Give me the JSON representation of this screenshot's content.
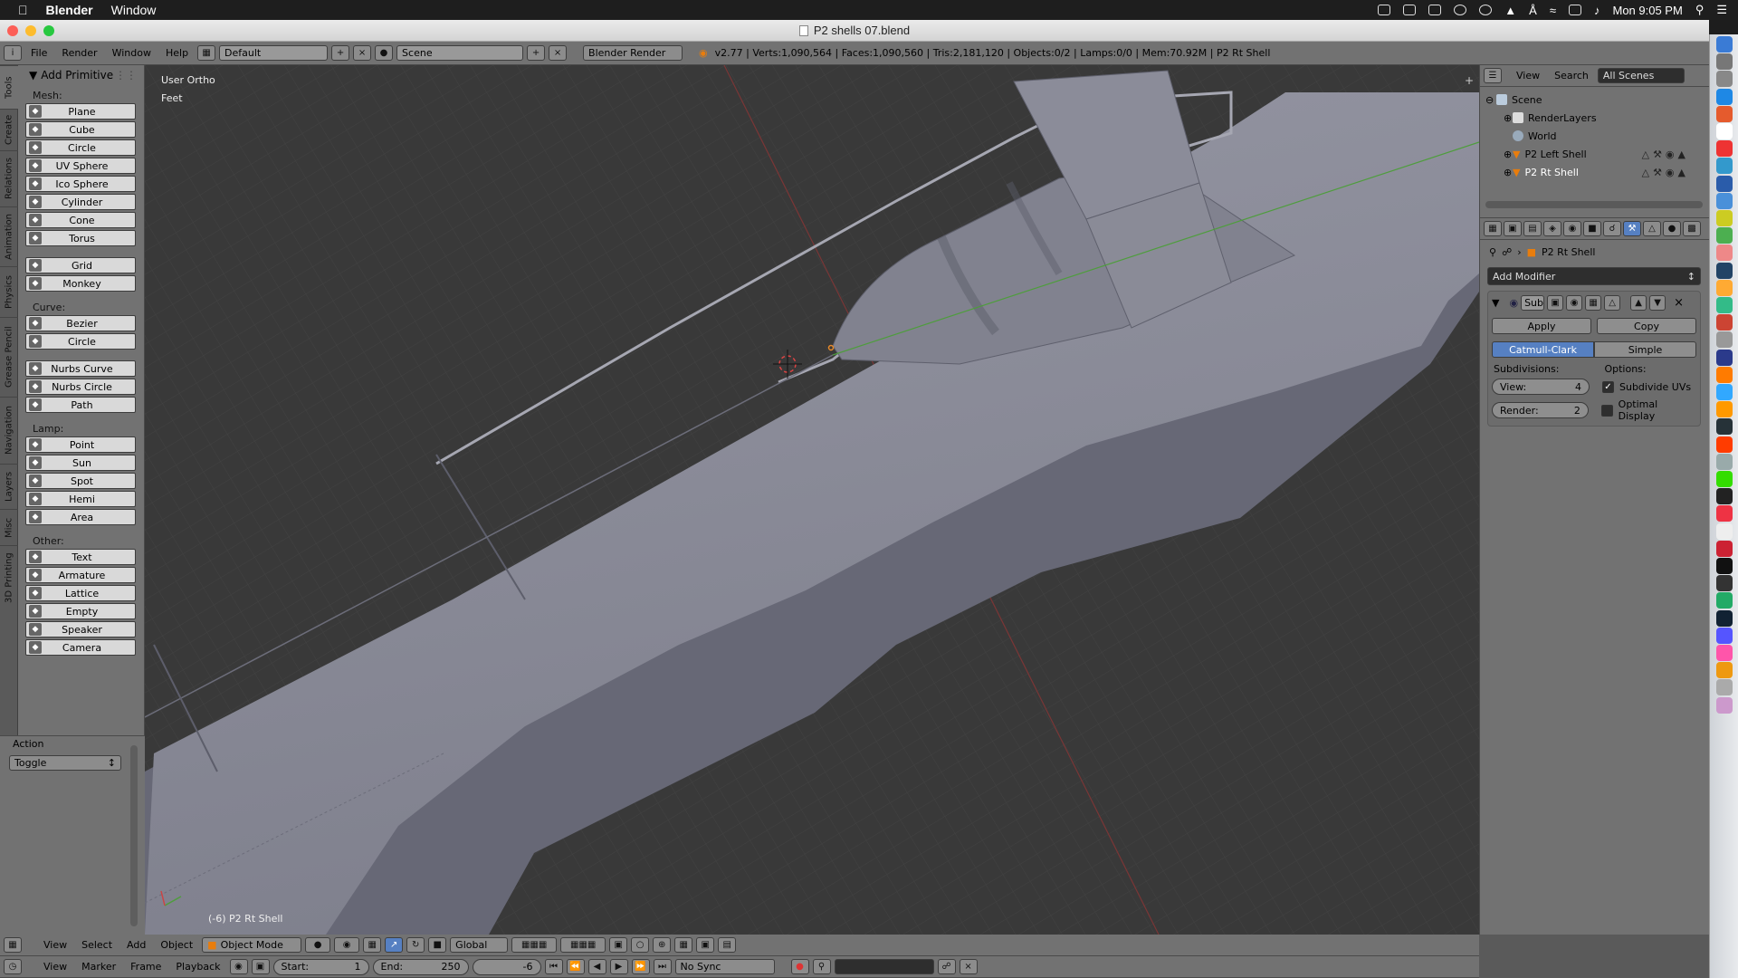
{
  "macos": {
    "apple_icon": "apple-icon",
    "app_name": "Blender",
    "menu_window": "Window",
    "clock": "Mon 9:05 PM",
    "tray_icons": [
      "hat-icon",
      "drive-icon",
      "dropbox-icon",
      "chat-icon",
      "timemachine-icon",
      "upload-icon",
      "bluetooth-icon",
      "wifi-icon",
      "keyboard-icon",
      "volume-icon"
    ]
  },
  "window": {
    "title": "P2 shells 07.blend"
  },
  "info_header": {
    "menus": [
      "File",
      "Render",
      "Window",
      "Help"
    ],
    "layout": "Default",
    "scene": "Scene",
    "engine": "Blender Render",
    "stats": "v2.77 | Verts:1,090,564 | Faces:1,090,560 | Tris:2,181,120 | Objects:0/2 | Lamps:0/0 | Mem:70.92M | P2 Rt Shell"
  },
  "tool_tabs": [
    "Tools",
    "Create",
    "Relations",
    "Animation",
    "Physics",
    "Grease Pencil",
    "Navigation",
    "Layers",
    "Misc",
    "3D Printing"
  ],
  "shelf": {
    "panel_title": "Add Primitive",
    "groups": [
      {
        "label": "Mesh:",
        "items": [
          {
            "label": "Plane",
            "icon": "plane-icon"
          },
          {
            "label": "Cube",
            "icon": "cube-icon"
          },
          {
            "label": "Circle",
            "icon": "circle-icon"
          },
          {
            "label": "UV Sphere",
            "icon": "uv-sphere-icon"
          },
          {
            "label": "Ico Sphere",
            "icon": "ico-sphere-icon"
          },
          {
            "label": "Cylinder",
            "icon": "cylinder-icon"
          },
          {
            "label": "Cone",
            "icon": "cone-icon"
          },
          {
            "label": "Torus",
            "icon": "torus-icon"
          }
        ]
      },
      {
        "label": "",
        "items": [
          {
            "label": "Grid",
            "icon": "grid-icon"
          },
          {
            "label": "Monkey",
            "icon": "monkey-icon"
          }
        ]
      },
      {
        "label": "Curve:",
        "items": [
          {
            "label": "Bezier",
            "icon": "bezier-icon"
          },
          {
            "label": "Circle",
            "icon": "curve-circle-icon"
          }
        ]
      },
      {
        "label": "",
        "items": [
          {
            "label": "Nurbs Curve",
            "icon": "nurbs-curve-icon"
          },
          {
            "label": "Nurbs Circle",
            "icon": "nurbs-circle-icon"
          },
          {
            "label": "Path",
            "icon": "path-icon"
          }
        ]
      },
      {
        "label": "Lamp:",
        "items": [
          {
            "label": "Point",
            "icon": "point-lamp-icon"
          },
          {
            "label": "Sun",
            "icon": "sun-lamp-icon"
          },
          {
            "label": "Spot",
            "icon": "spot-lamp-icon"
          },
          {
            "label": "Hemi",
            "icon": "hemi-lamp-icon"
          },
          {
            "label": "Area",
            "icon": "area-lamp-icon"
          }
        ]
      },
      {
        "label": "Other:",
        "items": [
          {
            "label": "Text",
            "icon": "text-icon"
          },
          {
            "label": "Armature",
            "icon": "armature-icon"
          },
          {
            "label": "Lattice",
            "icon": "lattice-icon"
          },
          {
            "label": "Empty",
            "icon": "empty-icon"
          },
          {
            "label": "Speaker",
            "icon": "speaker-icon"
          },
          {
            "label": "Camera",
            "icon": "camera-icon"
          }
        ]
      }
    ]
  },
  "operator": {
    "title": "Action",
    "value": "Toggle"
  },
  "viewport": {
    "view_name": "User Ortho",
    "units": "Feet",
    "object_label": "(-6) P2 Rt Shell"
  },
  "outliner": {
    "menus": [
      "View",
      "Search"
    ],
    "filter": "All Scenes",
    "items": [
      {
        "label": "Scene",
        "level": 0
      },
      {
        "label": "RenderLayers",
        "level": 1
      },
      {
        "label": "World",
        "level": 1
      },
      {
        "label": "P2 Left Shell",
        "level": 1
      },
      {
        "label": "P2 Rt Shell",
        "level": 1
      }
    ]
  },
  "properties": {
    "object_name": "P2 Rt Shell",
    "add_modifier": "Add Modifier",
    "modifier_name": "Sub",
    "apply": "Apply",
    "copy": "Copy",
    "type_a": "Catmull-Clark",
    "type_b": "Simple",
    "subdivisions_label": "Subdivisions:",
    "options_label": "Options:",
    "view_label": "View:",
    "view_value": "4",
    "render_label": "Render:",
    "render_value": "2",
    "subdivide_uvs": "Subdivide UVs",
    "optimal_display": "Optimal Display"
  },
  "viewport_header": {
    "menus": [
      "View",
      "Select",
      "Add",
      "Object"
    ],
    "mode": "Object Mode",
    "orientation": "Global"
  },
  "timeline": {
    "menus": [
      "View",
      "Marker",
      "Frame",
      "Playback"
    ],
    "start_label": "Start:",
    "start": "1",
    "end_label": "End:",
    "end": "250",
    "current": "-6",
    "sync": "No Sync"
  },
  "colors": {
    "accent": "#5680c2",
    "viewport_bg": "#393939",
    "header_bg": "#727272",
    "object": "#8e8f9c"
  }
}
